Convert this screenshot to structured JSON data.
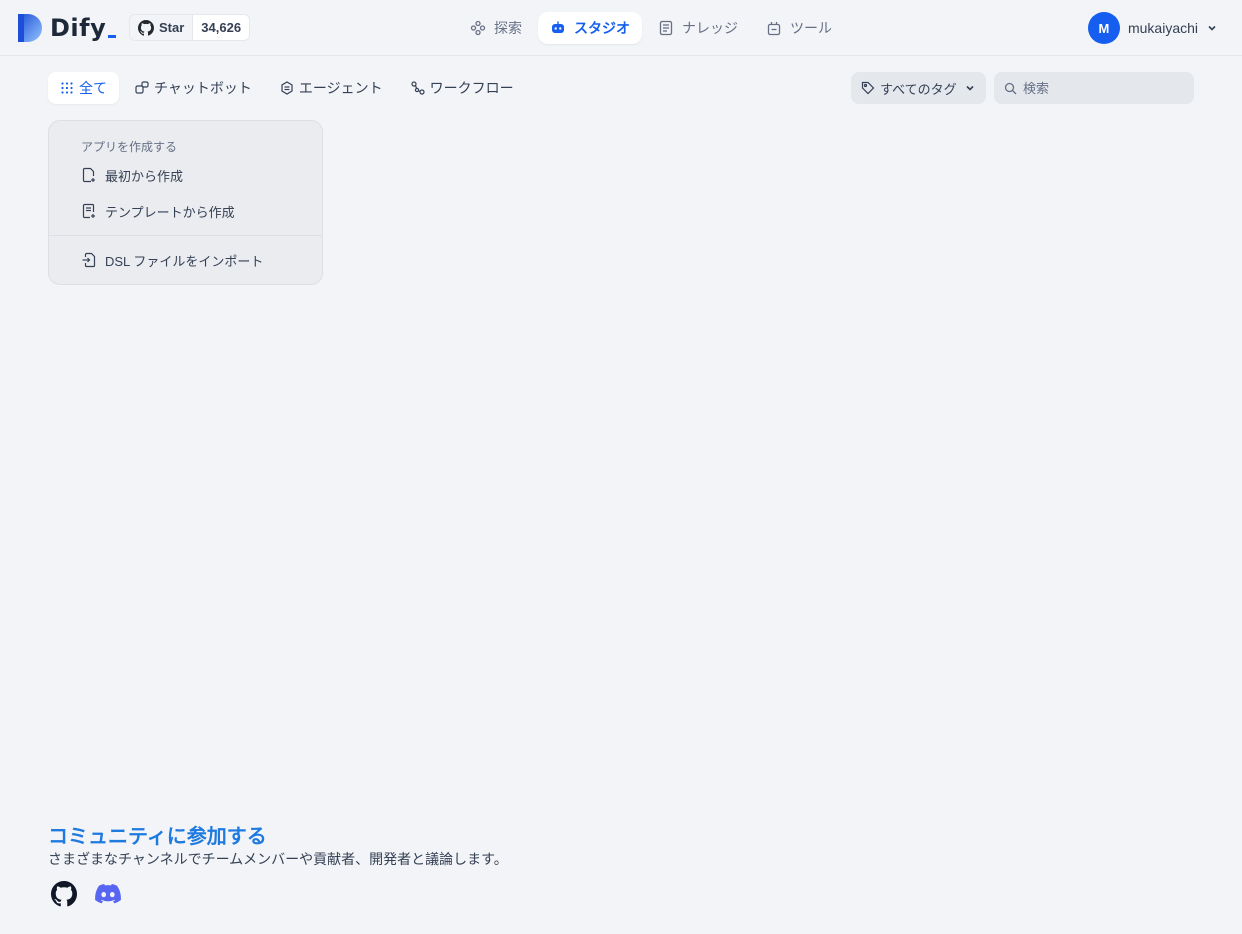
{
  "brand": {
    "name": "Dify"
  },
  "github": {
    "star_label": "Star",
    "star_count": "34,626"
  },
  "nav": {
    "items": [
      {
        "label": "探索",
        "icon": "explore-icon"
      },
      {
        "label": "スタジオ",
        "icon": "studio-robot-icon",
        "active": true
      },
      {
        "label": "ナレッジ",
        "icon": "knowledge-book-icon"
      },
      {
        "label": "ツール",
        "icon": "tools-icon"
      }
    ]
  },
  "user": {
    "initial": "M",
    "name": "mukaiyachi"
  },
  "filters": {
    "tabs": [
      {
        "label": "全て",
        "icon": "grid-icon",
        "active": true
      },
      {
        "label": "チャットボット",
        "icon": "chatbot-icon"
      },
      {
        "label": "エージェント",
        "icon": "agent-icon"
      },
      {
        "label": "ワークフロー",
        "icon": "workflow-icon"
      }
    ],
    "tag_filter_label": "すべてのタグ",
    "search_placeholder": "検索"
  },
  "create_card": {
    "title": "アプリを作成する",
    "from_scratch": "最初から作成",
    "from_template": "テンプレートから作成",
    "import_dsl": "DSL ファイルをインポート"
  },
  "community": {
    "title": "コミュニティに参加する",
    "description": "さまざまなチャンネルでチームメンバーや貢献者、開発者と議論します。"
  },
  "colors": {
    "accent": "#155eef",
    "background": "#f2f4f7",
    "community_title": "#1f7ae0",
    "discord": "#5865f2"
  }
}
